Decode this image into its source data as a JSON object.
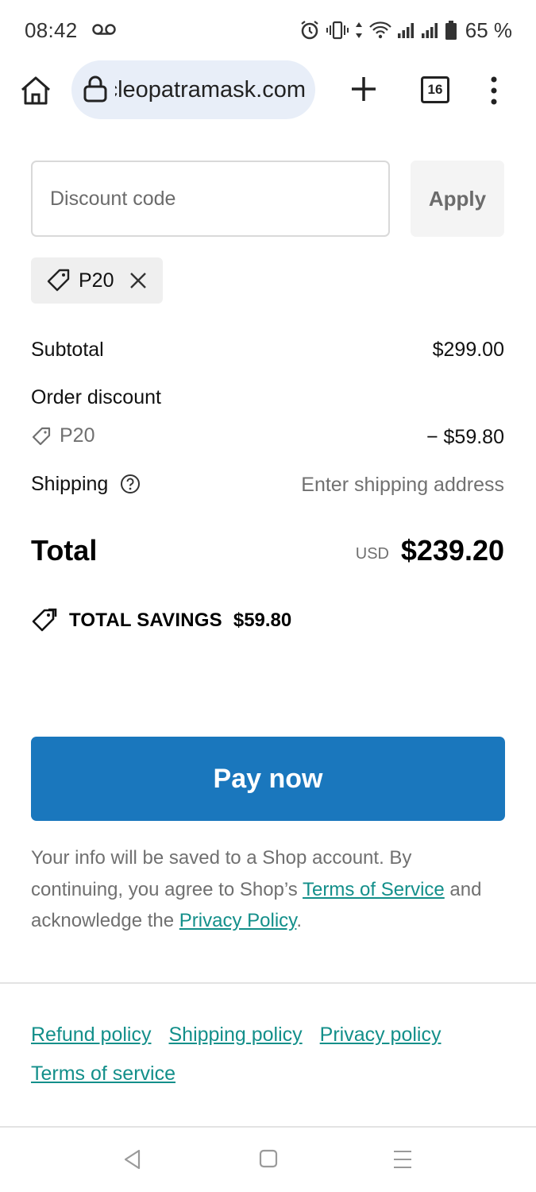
{
  "status_bar": {
    "time": "08:42",
    "battery_text": "65 %",
    "icons": [
      "voicemail-icon",
      "alarm-icon",
      "vibrate-icon",
      "data-arrows-icon",
      "wifi-icon",
      "signal-icon",
      "signal-icon",
      "battery-icon"
    ]
  },
  "browser": {
    "url": "cleopatramask.com",
    "tab_count": "16",
    "icons": [
      "home-icon",
      "lock-icon",
      "new-tab-icon",
      "tabs-icon",
      "more-menu-icon"
    ]
  },
  "discount": {
    "placeholder": "Discount code",
    "apply_label": "Apply",
    "applied_code": "P20"
  },
  "summary": {
    "subtotal_label": "Subtotal",
    "subtotal_value": "$299.00",
    "order_discount_label": "Order discount",
    "discount_code": "P20",
    "discount_value": "− $59.80",
    "shipping_label": "Shipping",
    "shipping_value": "Enter shipping address",
    "total_label": "Total",
    "total_currency": "USD",
    "total_value": "$239.20",
    "savings_label": "TOTAL SAVINGS",
    "savings_value": "$59.80"
  },
  "checkout": {
    "pay_label": "Pay now",
    "legal_prefix": "Your info will be saved to a Shop account. By continuing, you agree to Shop’s ",
    "terms_link": "Terms of Service",
    "legal_middle": " and acknowledge the ",
    "privacy_link": "Privacy Policy",
    "legal_suffix": "."
  },
  "footer": {
    "links": [
      "Refund policy",
      "Shipping policy",
      "Privacy policy",
      "Terms of service"
    ]
  },
  "colors": {
    "pay_button": "#1a77bd",
    "link": "#138f8a",
    "url_pill": "#e8eef8"
  }
}
